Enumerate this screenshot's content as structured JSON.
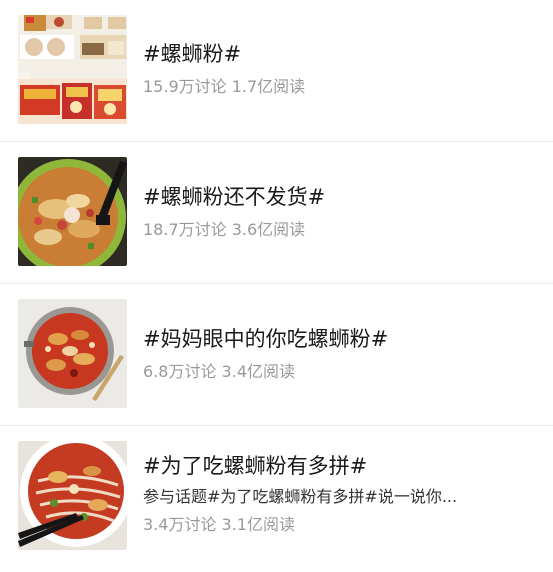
{
  "topics": [
    {
      "title": "#螺蛳粉#",
      "discussions": "15.9万讨论",
      "reads": "1.7亿阅读",
      "thumbnail": "instant-noodle-packages"
    },
    {
      "title": "#螺蛳粉还不发货#",
      "discussions": "18.7万讨论",
      "reads": "3.6亿阅读",
      "thumbnail": "noodle-bowl-with-chopsticks"
    },
    {
      "title": "#妈妈眼中的你吃螺蛳粉#",
      "discussions": "6.8万讨论",
      "reads": "3.4亿阅读",
      "thumbnail": "spicy-noodle-pot"
    },
    {
      "title": "#为了吃螺蛳粉有多拼#",
      "description": "参与话题#为了吃螺蛳粉有多拼#说一说你...",
      "discussions": "3.4万讨论",
      "reads": "3.1亿阅读",
      "thumbnail": "red-noodle-soup-bowl"
    }
  ]
}
